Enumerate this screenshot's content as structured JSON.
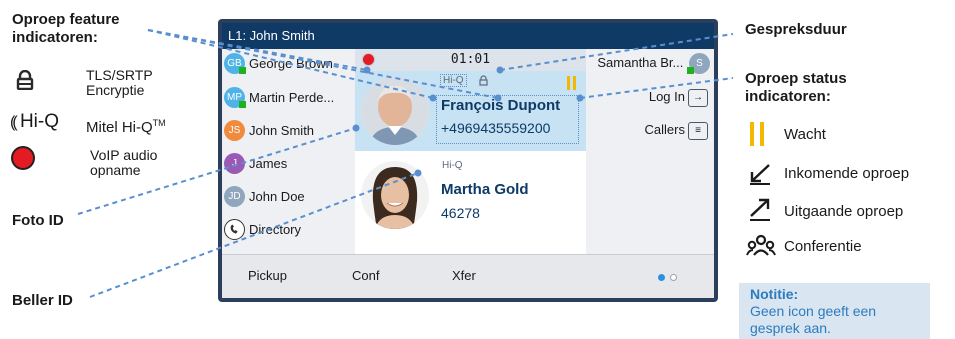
{
  "legend_left": {
    "title_line1": "Oproep feature",
    "title_line2": "indicatoren:",
    "items": [
      {
        "label_line1": "TLS/SRTP",
        "label_line2": "Encryptie",
        "icon": "lock-icon"
      },
      {
        "prefix": "Hi-Q",
        "label": "Mitel Hi-Q",
        "tm": "TM",
        "icon": "hiq-icon"
      },
      {
        "label_line1": "VoIP audio",
        "label_line2": "opname",
        "icon": "record-icon"
      }
    ]
  },
  "callouts": {
    "foto_id": "Foto ID",
    "beller_id": "Beller ID",
    "gespreksduur": "Gespreksduur"
  },
  "legend_right": {
    "title_line1": "Oproep status",
    "title_line2": "indicatoren:",
    "items": [
      {
        "label": "Wacht",
        "icon": "hold-icon"
      },
      {
        "label": "Inkomende oproep",
        "icon": "incoming-call-icon"
      },
      {
        "label": "Uitgaande oproep",
        "icon": "outgoing-call-icon"
      },
      {
        "label": "Conferentie",
        "icon": "conference-icon"
      }
    ],
    "note_title": "Notitie:",
    "note_line1": "Geen icon geeft een",
    "note_line2": "gesprek aan."
  },
  "phone": {
    "line_title": "L1: John Smith",
    "timer": "01:01",
    "contacts_left": [
      {
        "initials": "GB",
        "name": "George Brown",
        "color": "#4fb3e8",
        "presence": true
      },
      {
        "initials": "MP",
        "name": "Martin Perde...",
        "color": "#4fb3e8",
        "presence": true
      },
      {
        "initials": "JS",
        "name": "John Smith",
        "color": "#f08a3c",
        "presence": false
      },
      {
        "initials": "J",
        "name": "James",
        "color": "#9b59b6",
        "presence": false
      },
      {
        "initials": "JD",
        "name": "John Doe",
        "color": "#8fa6bd",
        "presence": false
      },
      {
        "initials": "",
        "name": "Directory",
        "color": "#ffffff",
        "presence": false
      }
    ],
    "calls": [
      {
        "hiq": "Hi-Q",
        "name": "François Dupont",
        "number": "+4969435559200",
        "status": "hold"
      },
      {
        "hiq": "Hi-Q",
        "name": "Martha Gold",
        "number": "46278",
        "status": ""
      }
    ],
    "right_keys": [
      {
        "label": "Samantha Br...",
        "initials": "S",
        "presence": true
      },
      {
        "label": "Log In"
      },
      {
        "label": "Callers"
      }
    ],
    "softkeys": [
      "Pickup",
      "Conf",
      "Xfer"
    ],
    "page_indicator": {
      "current": 1,
      "total": 2
    }
  },
  "colors": {
    "accent": "#0f3a66",
    "hold": "#f5b800",
    "record": "#e31b23",
    "presence": "#1fb21f",
    "callout_line": "#5a8fcf"
  }
}
